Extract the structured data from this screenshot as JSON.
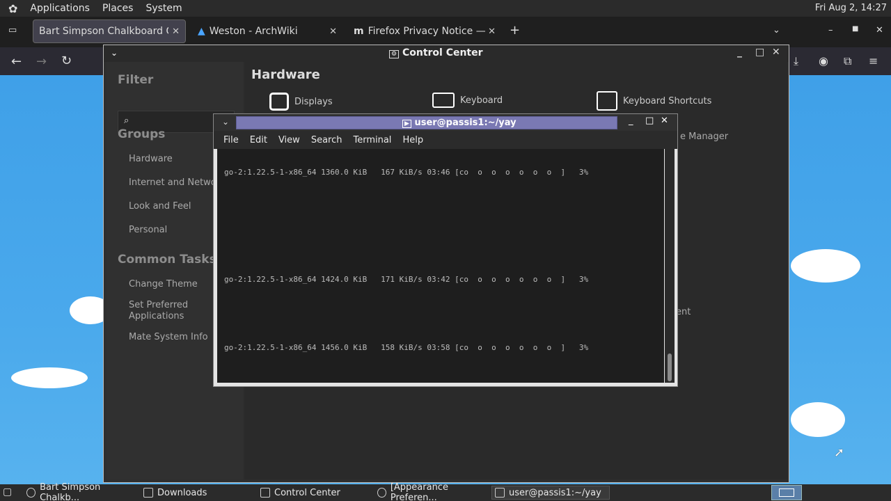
{
  "top_panel": {
    "menus": [
      "Applications",
      "Places",
      "System"
    ],
    "clock": "Fri Aug  2, 14:27"
  },
  "browser": {
    "tabs": [
      {
        "label": "Bart Simpson Chalkboard Gene"
      },
      {
        "label": "Weston - ArchWiki"
      },
      {
        "label": "Firefox Privacy Notice — Mo"
      }
    ]
  },
  "control_center": {
    "title": "Control Center",
    "filter_label": "Filter",
    "groups_label": "Groups",
    "groups": [
      "Hardware",
      "Internet and Network",
      "Look and Feel",
      "Personal"
    ],
    "tasks_label": "Common Tasks",
    "tasks": [
      "Change Theme",
      "Set Preferred Applications",
      "Mate System Info"
    ],
    "section_title": "Hardware",
    "items": [
      "Displays",
      "Keyboard",
      "Keyboard Shortcuts"
    ],
    "partial_labels": [
      "e Manager",
      "ent"
    ]
  },
  "terminal": {
    "title": "user@passis1:~/yay",
    "menu": [
      "File",
      "Edit",
      "View",
      "Search",
      "Terminal",
      "Help"
    ],
    "lines": [
      "go-2:1.22.5-1-x86_64 1360.0 KiB   167 KiB/s 03:46 [co  o  o  o  o  o  o  ]   3%",
      "go-2:1.22.5-1-x86_64 1424.0 KiB   171 KiB/s 03:42 [co  o  o  o  o  o  o  ]   3%",
      "go-2:1.22.5-1-x86_64 1456.0 KiB   158 KiB/s 03:58 [co  o  o  o  o  o  o  ]   3%"
    ]
  },
  "taskbar": {
    "tasks": [
      {
        "label": "Bart Simpson Chalkb..."
      },
      {
        "label": "Downloads"
      },
      {
        "label": "Control Center"
      },
      {
        "label": "[Appearance Preferen..."
      },
      {
        "label": "user@passis1:~/yay"
      }
    ]
  }
}
